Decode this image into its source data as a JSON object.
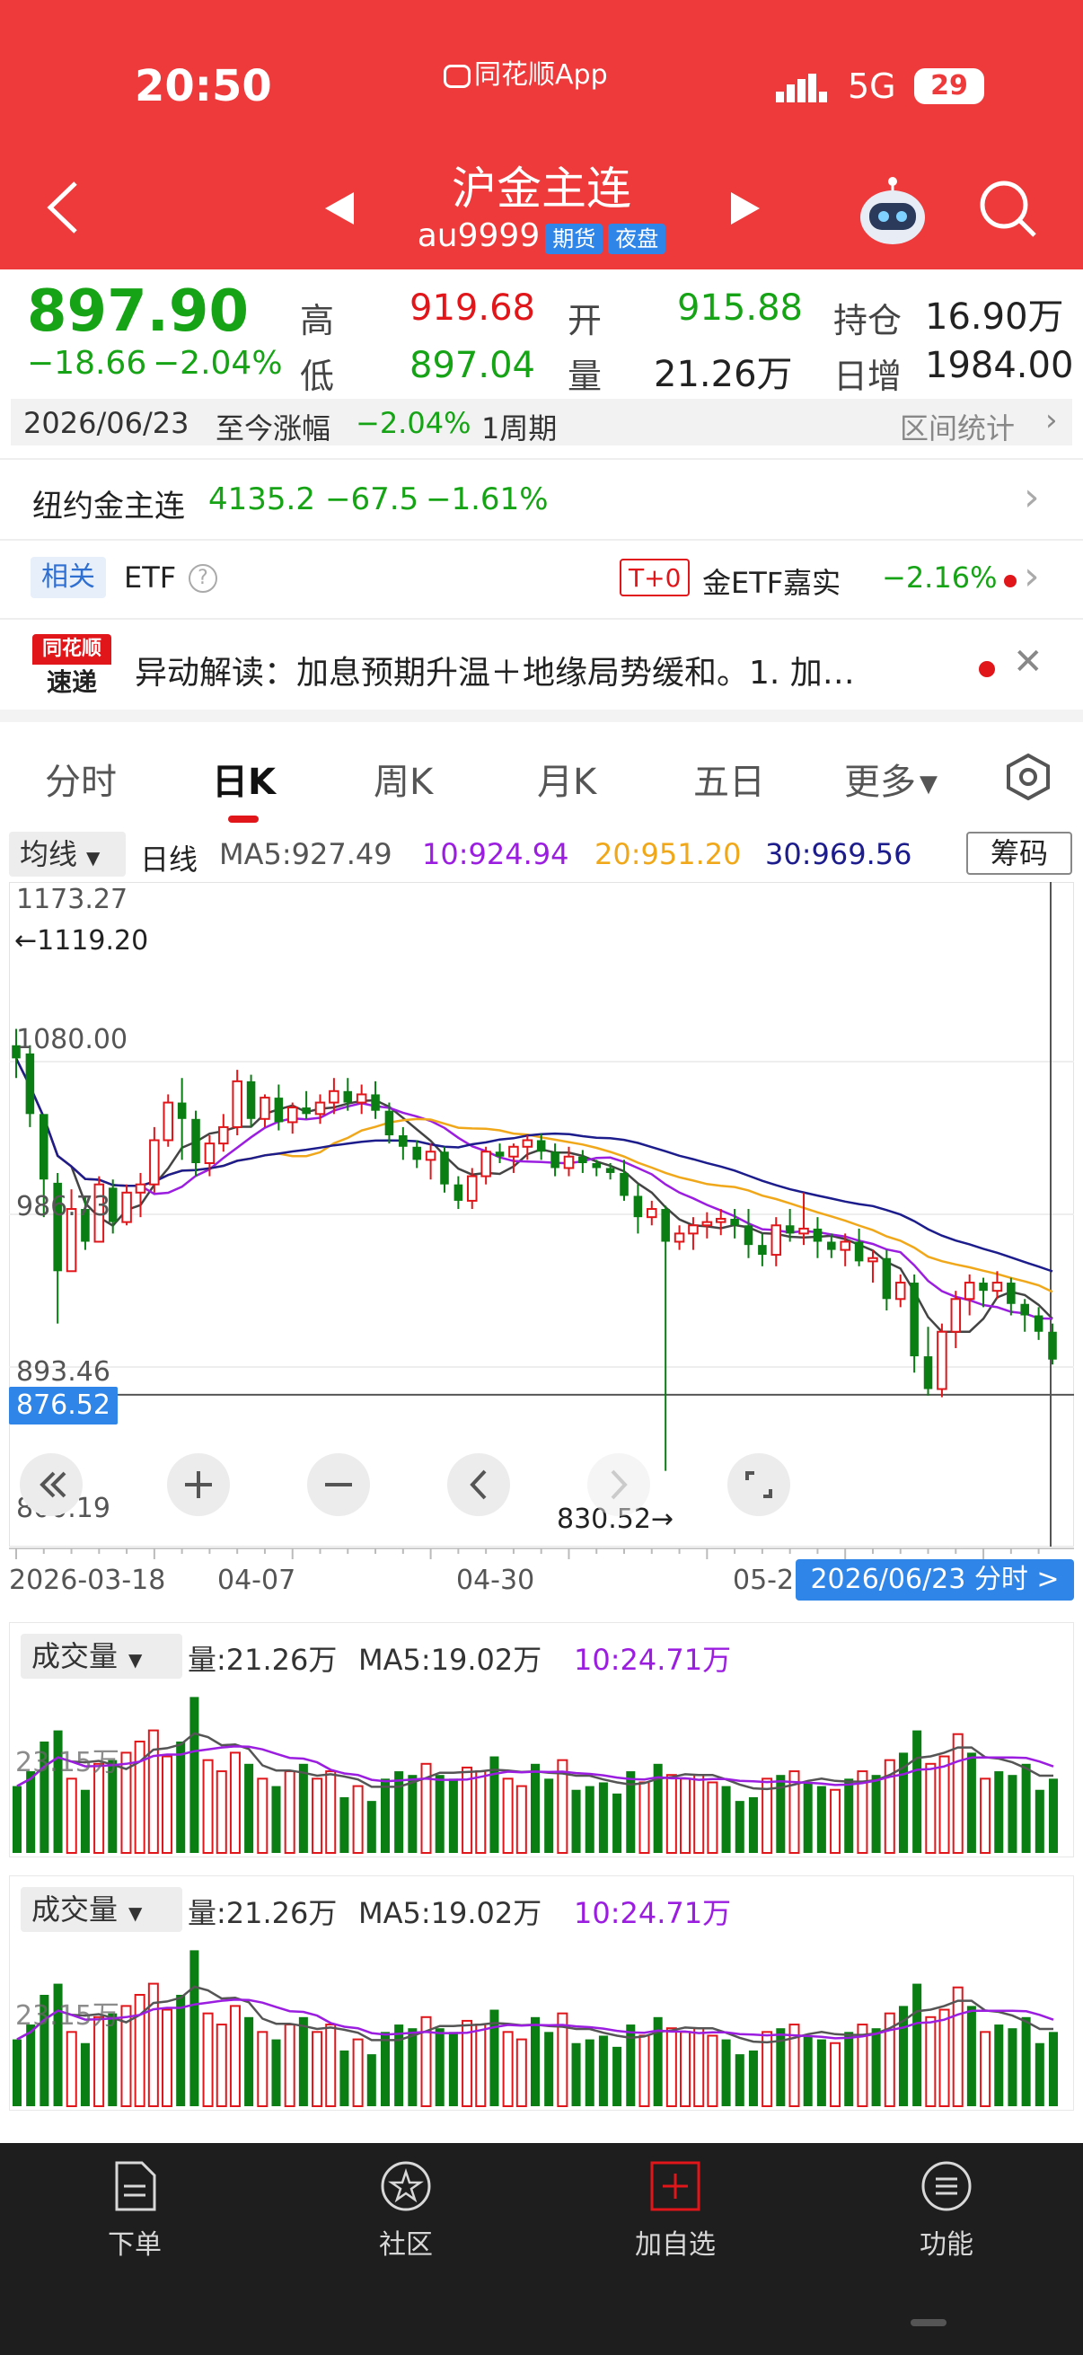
{
  "status_bar": {
    "time": "20:50",
    "app_label": "同花顺App",
    "network": "5G",
    "battery": "29"
  },
  "header": {
    "title": "沪金主连",
    "code": "au9999",
    "tag_futures": "期货",
    "tag_night": "夜盘"
  },
  "quote": {
    "price": "897.90",
    "change": "−18.66",
    "change_pct": "−2.04%",
    "high_label": "高",
    "high": "919.68",
    "open_label": "开",
    "open": "915.88",
    "oi_label": "持仓",
    "oi": "16.90万",
    "low_label": "低",
    "low": "897.04",
    "vol_label": "量",
    "vol": "21.26万",
    "daily_inc_label": "日增",
    "daily_inc": "1984.00"
  },
  "period_bar": {
    "date": "2026/06/23",
    "label": "至今涨幅",
    "pct": "−2.04%",
    "period": "1周期",
    "stats": "区间统计"
  },
  "related_comex": {
    "name": "纽约金主连",
    "price": "4135.2",
    "change": "−67.5",
    "pct": "−1.61%"
  },
  "etf_row": {
    "tag": "相关",
    "etf": "ETF",
    "t0": "T+0",
    "etf_name": "金ETF嘉实",
    "etf_pct": "−2.16%"
  },
  "news": {
    "logo_top": "同花顺",
    "logo_bottom": "速递",
    "text": "异动解读：加息预期升温＋地缘局势缓和。1. 加…"
  },
  "tabs": [
    "分时",
    "日K",
    "周K",
    "月K",
    "五日",
    "更多"
  ],
  "ma_bar": {
    "dropdown": "均线",
    "type": "日线",
    "ma5": "MA5:927.49",
    "ma10": "10:924.94",
    "ma20": "20:951.20",
    "ma30": "30:969.56",
    "chip": "筹码"
  },
  "chart_data": {
    "type": "candlestick",
    "y_ticks": [
      "1173.27",
      "1080.00",
      "986.73",
      "893.46",
      "800.19"
    ],
    "ylim": [
      800.19,
      1173.27
    ],
    "x_ticks": [
      "2026-03-18",
      "04-07",
      "04-30",
      "05-2"
    ],
    "max_marker": "←1119.20",
    "min_marker": "830.52→",
    "cursor_price": "876.52",
    "cursor_date": "2026/06/23 分时 >",
    "colors": {
      "up": "#e0161b",
      "down": "#0a7d13",
      "ma5": "#444444",
      "ma10": "#9b1ee0",
      "ma20": "#f0a81a",
      "ma30": "#1c1c8c"
    },
    "candles": [
      [
        1090,
        1100,
        1070,
        1082
      ],
      [
        1085,
        1090,
        1040,
        1048
      ],
      [
        1048,
        1025,
        985,
        1008
      ],
      [
        1006,
        1012,
        920,
        952
      ],
      [
        952,
        1002,
        975,
        990
      ],
      [
        990,
        998,
        965,
        970
      ],
      [
        970,
        1010,
        970,
        1005
      ],
      [
        1003,
        1008,
        975,
        982
      ],
      [
        982,
        1005,
        980,
        1000
      ],
      [
        1000,
        1012,
        985,
        1005
      ],
      [
        1005,
        1040,
        1000,
        1032
      ],
      [
        1032,
        1060,
        1028,
        1055
      ],
      [
        1055,
        1070,
        1020,
        1045
      ],
      [
        1045,
        1050,
        1010,
        1018
      ],
      [
        1018,
        1035,
        1010,
        1030
      ],
      [
        1030,
        1048,
        1025,
        1040
      ],
      [
        1040,
        1075,
        1035,
        1068
      ],
      [
        1068,
        1072,
        1040,
        1045
      ],
      [
        1045,
        1060,
        1040,
        1058
      ],
      [
        1058,
        1066,
        1038,
        1043
      ],
      [
        1043,
        1055,
        1036,
        1052
      ],
      [
        1052,
        1062,
        1045,
        1048
      ],
      [
        1048,
        1060,
        1042,
        1055
      ],
      [
        1055,
        1070,
        1048,
        1062
      ],
      [
        1062,
        1070,
        1050,
        1055
      ],
      [
        1055,
        1066,
        1048,
        1060
      ],
      [
        1060,
        1068,
        1045,
        1050
      ],
      [
        1050,
        1055,
        1030,
        1035
      ],
      [
        1035,
        1040,
        1020,
        1028
      ],
      [
        1028,
        1032,
        1015,
        1020
      ],
      [
        1020,
        1030,
        1008,
        1025
      ],
      [
        1025,
        1028,
        1000,
        1005
      ],
      [
        1005,
        1010,
        990,
        995
      ],
      [
        995,
        1015,
        990,
        1010
      ],
      [
        1010,
        1028,
        1005,
        1025
      ],
      [
        1025,
        1030,
        1018,
        1022
      ],
      [
        1022,
        1030,
        1012,
        1028
      ],
      [
        1028,
        1035,
        1020,
        1032
      ],
      [
        1032,
        1036,
        1020,
        1025
      ],
      [
        1025,
        1030,
        1010,
        1015
      ],
      [
        1015,
        1028,
        1010,
        1022
      ],
      [
        1022,
        1026,
        1012,
        1018
      ],
      [
        1018,
        1020,
        1010,
        1015
      ],
      [
        1015,
        1018,
        1008,
        1012
      ],
      [
        1012,
        1020,
        995,
        998
      ],
      [
        998,
        1005,
        975,
        985
      ],
      [
        985,
        995,
        980,
        990
      ],
      [
        990,
        992,
        830,
        970
      ],
      [
        970,
        980,
        965,
        975
      ],
      [
        975,
        985,
        965,
        980
      ],
      [
        980,
        988,
        972,
        982
      ],
      [
        982,
        990,
        974,
        984
      ],
      [
        984,
        990,
        972,
        980
      ],
      [
        980,
        990,
        960,
        968
      ],
      [
        968,
        975,
        955,
        962
      ],
      [
        962,
        985,
        955,
        980
      ],
      [
        980,
        990,
        970,
        975
      ],
      [
        975,
        1000,
        968,
        978
      ],
      [
        978,
        985,
        960,
        970
      ],
      [
        970,
        975,
        960,
        965
      ],
      [
        965,
        975,
        955,
        970
      ],
      [
        970,
        978,
        955,
        958
      ],
      [
        958,
        965,
        945,
        960
      ],
      [
        960,
        965,
        928,
        935
      ],
      [
        935,
        950,
        930,
        945
      ],
      [
        945,
        950,
        890,
        900
      ],
      [
        900,
        918,
        876,
        880
      ],
      [
        880,
        920,
        875,
        915
      ],
      [
        915,
        940,
        905,
        935
      ],
      [
        935,
        950,
        925,
        945
      ],
      [
        945,
        948,
        930,
        940
      ],
      [
        940,
        952,
        935,
        945
      ],
      [
        945,
        948,
        925,
        932
      ],
      [
        932,
        935,
        915,
        925
      ],
      [
        925,
        930,
        910,
        915
      ],
      [
        915,
        920,
        895,
        898
      ]
    ]
  },
  "chart_controls": [
    "fast-back",
    "zoom-in",
    "zoom-out",
    "prev",
    "next",
    "fullscreen"
  ],
  "volume_panels": [
    {
      "dropdown": "成交量",
      "vol": "量:21.26万",
      "ma5": "MA5:19.02万",
      "ma10": "10:24.71万",
      "ref": "23.15万"
    },
    {
      "dropdown": "成交量",
      "vol": "量:21.26万",
      "ma5": "MA5:19.02万",
      "ma10": "10:24.71万",
      "ref": "23.15万"
    }
  ],
  "volume_data": [
    18,
    22,
    30,
    33,
    20,
    17,
    24,
    25,
    27,
    30,
    33,
    26,
    30,
    42,
    25,
    22,
    27,
    24,
    20,
    18,
    22,
    24,
    20,
    22,
    15,
    18,
    14,
    20,
    22,
    21,
    24,
    21,
    20,
    23,
    22,
    26,
    20,
    18,
    24,
    20,
    25,
    17,
    18,
    19,
    16,
    22,
    19,
    24,
    21,
    20,
    21,
    19,
    18,
    14,
    15,
    20,
    21,
    22,
    19,
    18,
    17,
    20,
    22,
    21,
    25,
    27,
    33,
    24,
    26,
    32,
    27,
    20,
    22,
    21,
    24,
    17,
    20
  ],
  "bottom_nav": [
    {
      "label": "下单",
      "icon": "order-icon"
    },
    {
      "label": "社区",
      "icon": "community-icon"
    },
    {
      "label": "加自选",
      "icon": "add-watch-icon"
    },
    {
      "label": "功能",
      "icon": "menu-icon"
    }
  ]
}
